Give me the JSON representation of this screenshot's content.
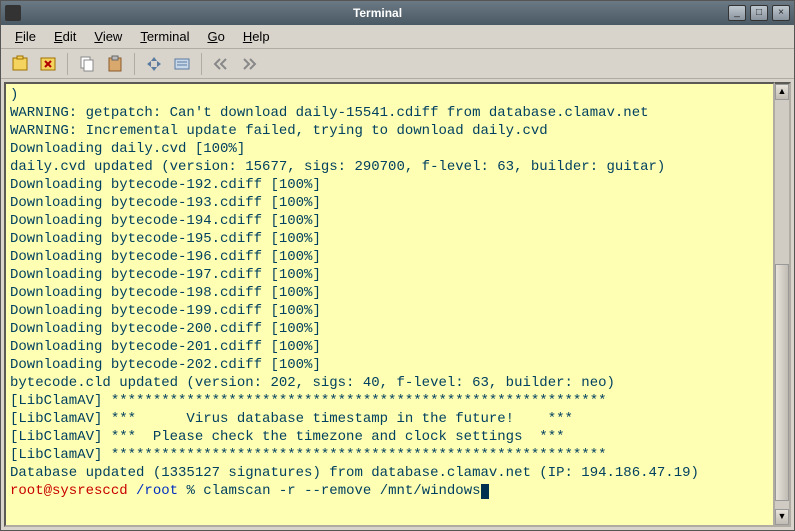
{
  "window": {
    "title": "Terminal"
  },
  "menubar": {
    "items": [
      {
        "label": "File",
        "ul": "F"
      },
      {
        "label": "Edit",
        "ul": "E"
      },
      {
        "label": "View",
        "ul": "V"
      },
      {
        "label": "Terminal",
        "ul": "T"
      },
      {
        "label": "Go",
        "ul": "G"
      },
      {
        "label": "Help",
        "ul": "H"
      }
    ]
  },
  "toolbar": {
    "icons": [
      "new-tab-icon",
      "close-tab-icon",
      "copy-icon",
      "paste-icon",
      "fullscreen-icon",
      "settings-icon",
      "prev-tab-icon",
      "next-tab-icon"
    ]
  },
  "terminal": {
    "lines": [
      ")",
      "WARNING: getpatch: Can't download daily-15541.cdiff from database.clamav.net",
      "WARNING: Incremental update failed, trying to download daily.cvd",
      "Downloading daily.cvd [100%]",
      "daily.cvd updated (version: 15677, sigs: 290700, f-level: 63, builder: guitar)",
      "Downloading bytecode-192.cdiff [100%]",
      "Downloading bytecode-193.cdiff [100%]",
      "Downloading bytecode-194.cdiff [100%]",
      "Downloading bytecode-195.cdiff [100%]",
      "Downloading bytecode-196.cdiff [100%]",
      "Downloading bytecode-197.cdiff [100%]",
      "Downloading bytecode-198.cdiff [100%]",
      "Downloading bytecode-199.cdiff [100%]",
      "Downloading bytecode-200.cdiff [100%]",
      "Downloading bytecode-201.cdiff [100%]",
      "Downloading bytecode-202.cdiff [100%]",
      "bytecode.cld updated (version: 202, sigs: 40, f-level: 63, builder: neo)",
      "[LibClamAV] ***********************************************************",
      "[LibClamAV] ***      Virus database timestamp in the future!    ***",
      "[LibClamAV] ***  Please check the timezone and clock settings  ***",
      "[LibClamAV] ***********************************************************",
      "Database updated (1335127 signatures) from database.clamav.net (IP: 194.186.47.19)"
    ],
    "prompt": {
      "user": "root@sysresccd",
      "path": "/root",
      "symbol": "%",
      "command": "clamscan -r --remove /mnt/windows"
    }
  }
}
